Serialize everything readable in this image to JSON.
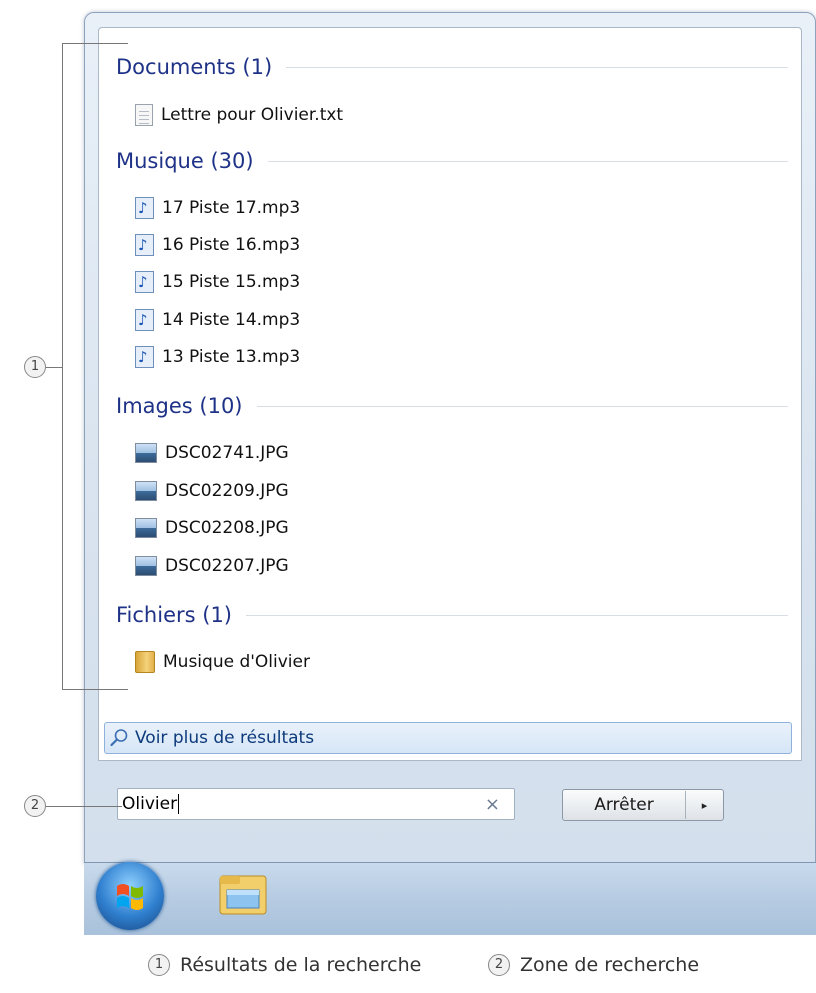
{
  "groups": [
    {
      "title": "Documents (1)",
      "icon": "text-file-icon",
      "items": [
        "Lettre pour Olivier.txt"
      ]
    },
    {
      "title": "Musique (30)",
      "icon": "music-file-icon",
      "items": [
        "17 Piste 17.mp3",
        "16 Piste 16.mp3",
        "15 Piste 15.mp3",
        "14 Piste 14.mp3",
        "13 Piste 13.mp3"
      ]
    },
    {
      "title": "Images (10)",
      "icon": "image-file-icon",
      "items": [
        "DSC02741.JPG",
        "DSC02209.JPG",
        "DSC02208.JPG",
        "DSC02207.JPG"
      ]
    },
    {
      "title": "Fichiers (1)",
      "icon": "folder-icon",
      "items": [
        "Musique d'Olivier"
      ]
    }
  ],
  "more_results": {
    "label": "Voir plus de résultats",
    "icon": "search-icon"
  },
  "search": {
    "value": "Olivier",
    "clear_icon": "×"
  },
  "stop_button": {
    "label": "Arrêter",
    "arrow": "▸"
  },
  "taskbar": {
    "items": [
      "start-orb-icon",
      "windows-explorer-icon"
    ]
  },
  "callouts": {
    "one": "1",
    "two": "2"
  },
  "legend": {
    "one": "Résultats de la recherche",
    "two": "Zone de recherche"
  },
  "colors": {
    "group_title": "#1e3287",
    "accent_border": "#8fb2dc"
  }
}
